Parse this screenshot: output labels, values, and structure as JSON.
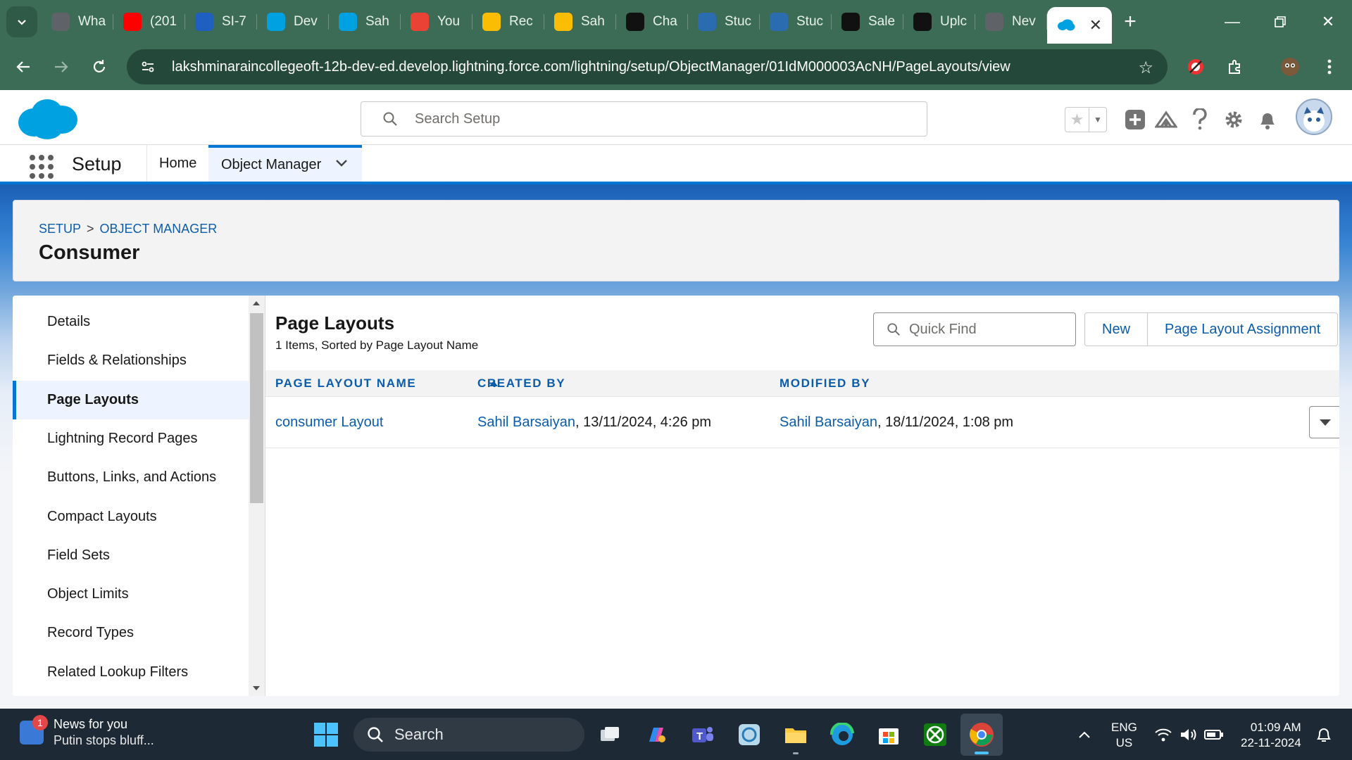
{
  "browser": {
    "tabs": [
      {
        "label": "Wha",
        "icon": "chrome-icon",
        "color": "#5f6368"
      },
      {
        "label": "(201",
        "icon": "youtube-icon",
        "color": "#ff0000"
      },
      {
        "label": "SI-7",
        "icon": "doc-icon",
        "color": "#1f5fbf"
      },
      {
        "label": "Dev",
        "icon": "salesforce-cloud-icon",
        "color": "#00a1e0"
      },
      {
        "label": "Sah",
        "icon": "salesforce-cloud-icon",
        "color": "#00a1e0"
      },
      {
        "label": "You",
        "icon": "gmail-icon",
        "color": "#ea4335"
      },
      {
        "label": "Rec",
        "icon": "drive-icon",
        "color": "#fbbc04"
      },
      {
        "label": "Sah",
        "icon": "drive-icon",
        "color": "#fbbc04"
      },
      {
        "label": "Cha",
        "icon": "chatgpt-icon",
        "color": "#111111"
      },
      {
        "label": "Stuc",
        "icon": "studio-icon",
        "color": "#2b6cb0"
      },
      {
        "label": "Stuc",
        "icon": "studio-icon",
        "color": "#2b6cb0"
      },
      {
        "label": "Sale",
        "icon": "chatgpt-icon",
        "color": "#111111"
      },
      {
        "label": "Uplc",
        "icon": "github-icon",
        "color": "#111111"
      },
      {
        "label": "Nev",
        "icon": "chrome-icon",
        "color": "#5f6368"
      }
    ],
    "active_tab_icon": "salesforce-cloud-icon",
    "url": "lakshminaraincollegeoft-12b-dev-ed.develop.lightning.force.com/lightning/setup/ObjectManager/01IdM000003AcNH/PageLayouts/view"
  },
  "sf_header": {
    "search_placeholder": "Search Setup"
  },
  "context_nav": {
    "app_name": "Setup",
    "tabs": [
      {
        "label": "Home"
      },
      {
        "label": "Object Manager"
      }
    ]
  },
  "page": {
    "breadcrumb": [
      "SETUP",
      "OBJECT MANAGER"
    ],
    "breadcrumb_sep": ">",
    "object_title": "Consumer"
  },
  "sidenav": {
    "items": [
      "Details",
      "Fields & Relationships",
      "Page Layouts",
      "Lightning Record Pages",
      "Buttons, Links, and Actions",
      "Compact Layouts",
      "Field Sets",
      "Object Limits",
      "Record Types",
      "Related Lookup Filters"
    ],
    "selected": "Page Layouts"
  },
  "content": {
    "title": "Page Layouts",
    "subtitle": "1 Items, Sorted by Page Layout Name",
    "quick_find_placeholder": "Quick Find",
    "buttons": [
      "New",
      "Page Layout Assignment"
    ],
    "columns": [
      "PAGE LAYOUT NAME",
      "CREATED BY",
      "MODIFIED BY"
    ],
    "rows": [
      {
        "name": "consumer Layout",
        "created_by_user": "Sahil Barsaiyan",
        "created_on": ", 13/11/2024, 4:26 pm",
        "modified_by_user": "Sahil Barsaiyan",
        "modified_on": ", 18/11/2024, 1:08 pm"
      }
    ]
  },
  "taskbar": {
    "news_title": "News for you",
    "news_headline": "Putin stops bluff...",
    "news_badge": "1",
    "search_label": "Search",
    "lang_1": "ENG",
    "lang_2": "US",
    "time": "01:09 AM",
    "date": "22-11-2024"
  },
  "colors": {
    "chrome_green": "#3c6b56",
    "salesforce_blue": "#0176d3",
    "link_blue": "#0b5cab"
  }
}
